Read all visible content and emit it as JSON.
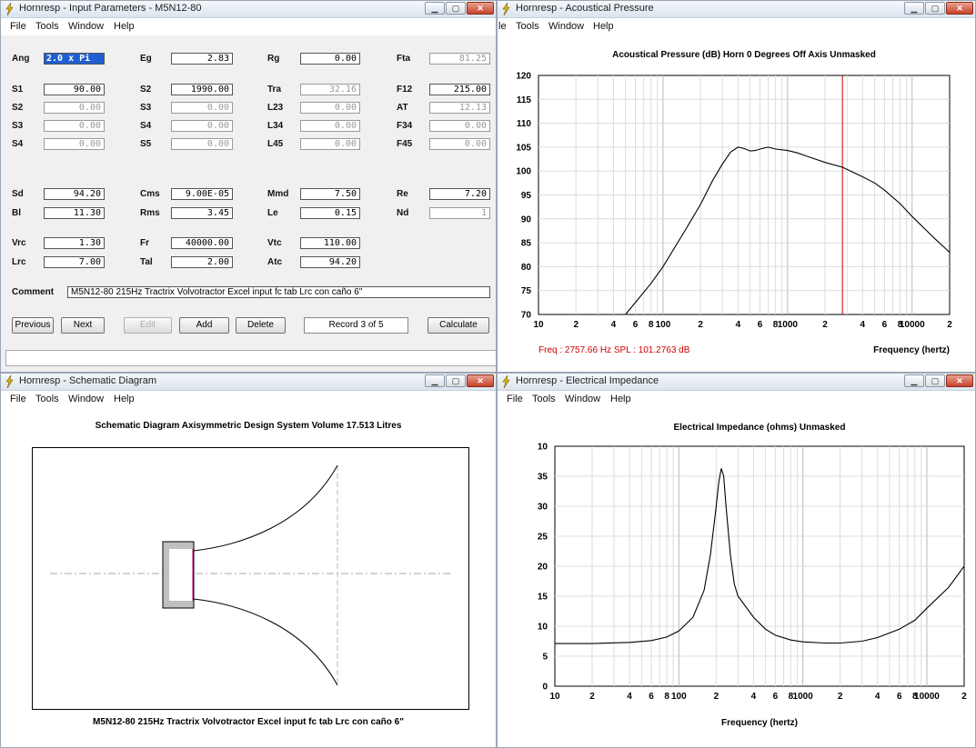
{
  "windows": {
    "input": {
      "title": "Hornresp - Input Parameters - M5N12-80",
      "menu": [
        "File",
        "Tools",
        "Window",
        "Help"
      ],
      "left_fields": [
        {
          "label": "Ang",
          "value": "2.0 x Pi",
          "gray": false,
          "selected": true,
          "row": 0
        },
        {
          "label": "S1",
          "value": "90.00",
          "gray": false,
          "row": 1
        },
        {
          "label": "S2",
          "value": "0.00",
          "gray": true,
          "row": 2
        },
        {
          "label": "S3",
          "value": "0.00",
          "gray": true,
          "row": 3
        },
        {
          "label": "S4",
          "value": "0.00",
          "gray": true,
          "row": 4
        },
        {
          "label": "Sd",
          "value": "94.20",
          "gray": false,
          "row": 5
        },
        {
          "label": "Bl",
          "value": "11.30",
          "gray": false,
          "row": 6
        },
        {
          "label": "Vrc",
          "value": "1.30",
          "gray": false,
          "row": 7
        },
        {
          "label": "Lrc",
          "value": "7.00",
          "gray": false,
          "row": 8
        }
      ],
      "col2_fields": [
        {
          "label": "Eg",
          "value": "2.83",
          "gray": false,
          "row": 0
        },
        {
          "label": "S2",
          "value": "1990.00",
          "gray": false,
          "row": 1
        },
        {
          "label": "S3",
          "value": "0.00",
          "gray": true,
          "row": 2
        },
        {
          "label": "S4",
          "value": "0.00",
          "gray": true,
          "row": 3
        },
        {
          "label": "S5",
          "value": "0.00",
          "gray": true,
          "row": 4
        },
        {
          "label": "Cms",
          "value": "9.00E-05",
          "gray": false,
          "row": 5
        },
        {
          "label": "Rms",
          "value": "3.45",
          "gray": false,
          "row": 6
        },
        {
          "label": "Fr",
          "value": "40000.00",
          "gray": false,
          "row": 7
        },
        {
          "label": "Tal",
          "value": "2.00",
          "gray": false,
          "row": 8
        }
      ],
      "col3_fields": [
        {
          "label": "Rg",
          "value": "0.00",
          "gray": false,
          "row": 0
        },
        {
          "label": "Tra",
          "value": "32.16",
          "gray": true,
          "row": 1
        },
        {
          "label": "L23",
          "value": "0.00",
          "gray": true,
          "row": 2
        },
        {
          "label": "L34",
          "value": "0.00",
          "gray": true,
          "row": 3
        },
        {
          "label": "L45",
          "value": "0.00",
          "gray": true,
          "row": 4
        },
        {
          "label": "Mmd",
          "value": "7.50",
          "gray": false,
          "row": 5
        },
        {
          "label": "Le",
          "value": "0.15",
          "gray": false,
          "row": 6
        },
        {
          "label": "Vtc",
          "value": "110.00",
          "gray": false,
          "row": 7
        },
        {
          "label": "Atc",
          "value": "94.20",
          "gray": false,
          "row": 8
        }
      ],
      "col4_fields": [
        {
          "label": "Fta",
          "value": "81.25",
          "gray": true,
          "row": 0
        },
        {
          "label": "F12",
          "value": "215.00",
          "gray": false,
          "row": 1
        },
        {
          "label": "AT",
          "value": "12.13",
          "gray": true,
          "row": 2
        },
        {
          "label": "F34",
          "value": "0.00",
          "gray": true,
          "row": 3
        },
        {
          "label": "F45",
          "value": "0.00",
          "gray": true,
          "row": 4
        },
        {
          "label": "Re",
          "value": "7.20",
          "gray": false,
          "row": 5
        },
        {
          "label": "Nd",
          "value": "1",
          "gray": true,
          "row": 6
        }
      ],
      "comment_label": "Comment",
      "comment_value": "M5N12-80   215Hz Tractrix Volvotractor Excel input fc tab   Lrc con caño 6\"",
      "buttons": {
        "previous": "Previous",
        "next": "Next",
        "edit": "Edit",
        "add": "Add",
        "delete": "Delete",
        "record": "Record 3 of 5",
        "calculate": "Calculate"
      }
    },
    "acoustic": {
      "title": "Hornresp - Acoustical Pressure",
      "menu": [
        "le",
        "Tools",
        "Window",
        "Help"
      ],
      "status_left": "Freq : 2757.66 Hz    SPL : 101.2763 dB",
      "status_right": "Frequency (hertz)"
    },
    "schematic": {
      "title": "Hornresp - Schematic Diagram",
      "menu": [
        "File",
        "Tools",
        "Window",
        "Help"
      ],
      "heading": "Schematic Diagram    Axisymmetric Design    System Volume 17.513 Litres",
      "footer": "M5N12-80   215Hz Tractrix Volvotractor Excel input fc tab   Lrc con caño 6\""
    },
    "impedance": {
      "title": "Hornresp - Electrical Impedance",
      "menu": [
        "File",
        "Tools",
        "Window",
        "Help"
      ]
    }
  },
  "chart_data": [
    {
      "type": "line",
      "title": "Acoustical Pressure (dB)    Horn    0 Degrees Off Axis    Unmasked",
      "xlabel": "Frequency (hertz)",
      "ylabel": "",
      "xscale": "log",
      "xlim": [
        10,
        20000
      ],
      "ylim": [
        70,
        120
      ],
      "yticks": [
        70,
        75,
        80,
        85,
        90,
        95,
        100,
        105,
        110,
        115,
        120
      ],
      "xtick_labels": [
        {
          "v": 10,
          "t": "10"
        },
        {
          "v": 20,
          "t": "2"
        },
        {
          "v": 40,
          "t": "4"
        },
        {
          "v": 60,
          "t": "6"
        },
        {
          "v": 80,
          "t": "8"
        },
        {
          "v": 100,
          "t": "100"
        },
        {
          "v": 200,
          "t": "2"
        },
        {
          "v": 400,
          "t": "4"
        },
        {
          "v": 600,
          "t": "6"
        },
        {
          "v": 800,
          "t": "8"
        },
        {
          "v": 1000,
          "t": "1000"
        },
        {
          "v": 2000,
          "t": "2"
        },
        {
          "v": 4000,
          "t": "4"
        },
        {
          "v": 6000,
          "t": "6"
        },
        {
          "v": 8000,
          "t": "8"
        },
        {
          "v": 10000,
          "t": "10000"
        },
        {
          "v": 20000,
          "t": "2"
        }
      ],
      "marker_x": 2757.66,
      "marker_color": "#cc0000",
      "grid": true,
      "series": [
        {
          "x": [
            50,
            60,
            80,
            100,
            150,
            200,
            250,
            300,
            350,
            400,
            450,
            500,
            550,
            600,
            700,
            800,
            1000,
            1200,
            1500,
            2000,
            2757,
            3500,
            4000,
            5000,
            6000,
            8000,
            10000,
            15000,
            20000
          ],
          "y": [
            70,
            72.5,
            76.5,
            80,
            87.5,
            93,
            98,
            101.5,
            104,
            105,
            104.7,
            104.2,
            104.3,
            104.6,
            105,
            104.6,
            104.3,
            103.8,
            102.9,
            101.8,
            100.8,
            99.5,
            98.8,
            97.5,
            96,
            93.2,
            90.5,
            86,
            83
          ]
        }
      ]
    },
    {
      "type": "line",
      "title": "Electrical Impedance (ohms)    Unmasked",
      "xlabel": "Frequency (hertz)",
      "ylabel": "",
      "xscale": "log",
      "xlim": [
        10,
        20000
      ],
      "ylim": [
        0,
        40
      ],
      "yticks": [
        0,
        5,
        10,
        15,
        20,
        25,
        30,
        35,
        40
      ],
      "ytick_labels": [
        "0",
        "5",
        "10",
        "15",
        "20",
        "25",
        "30",
        "35",
        "10"
      ],
      "xtick_labels": [
        {
          "v": 10,
          "t": "10"
        },
        {
          "v": 20,
          "t": "2"
        },
        {
          "v": 40,
          "t": "4"
        },
        {
          "v": 60,
          "t": "6"
        },
        {
          "v": 80,
          "t": "8"
        },
        {
          "v": 100,
          "t": "100"
        },
        {
          "v": 200,
          "t": "2"
        },
        {
          "v": 400,
          "t": "4"
        },
        {
          "v": 600,
          "t": "6"
        },
        {
          "v": 800,
          "t": "8"
        },
        {
          "v": 1000,
          "t": "1000"
        },
        {
          "v": 2000,
          "t": "2"
        },
        {
          "v": 4000,
          "t": "4"
        },
        {
          "v": 6000,
          "t": "6"
        },
        {
          "v": 8000,
          "t": "8"
        },
        {
          "v": 10000,
          "t": "10000"
        },
        {
          "v": 20000,
          "t": "2"
        }
      ],
      "grid": true,
      "series": [
        {
          "x": [
            10,
            20,
            40,
            60,
            80,
            100,
            130,
            160,
            180,
            200,
            210,
            220,
            230,
            240,
            260,
            280,
            300,
            400,
            500,
            600,
            800,
            1000,
            1500,
            2000,
            3000,
            4000,
            6000,
            8000,
            10000,
            15000,
            20000
          ],
          "y": [
            7.1,
            7.1,
            7.3,
            7.6,
            8.2,
            9.2,
            11.5,
            16,
            22,
            30,
            34,
            36.3,
            35,
            30,
            22,
            17,
            15,
            11.5,
            9.5,
            8.5,
            7.7,
            7.4,
            7.2,
            7.2,
            7.5,
            8.1,
            9.5,
            11,
            13,
            16.5,
            20
          ]
        }
      ]
    }
  ]
}
